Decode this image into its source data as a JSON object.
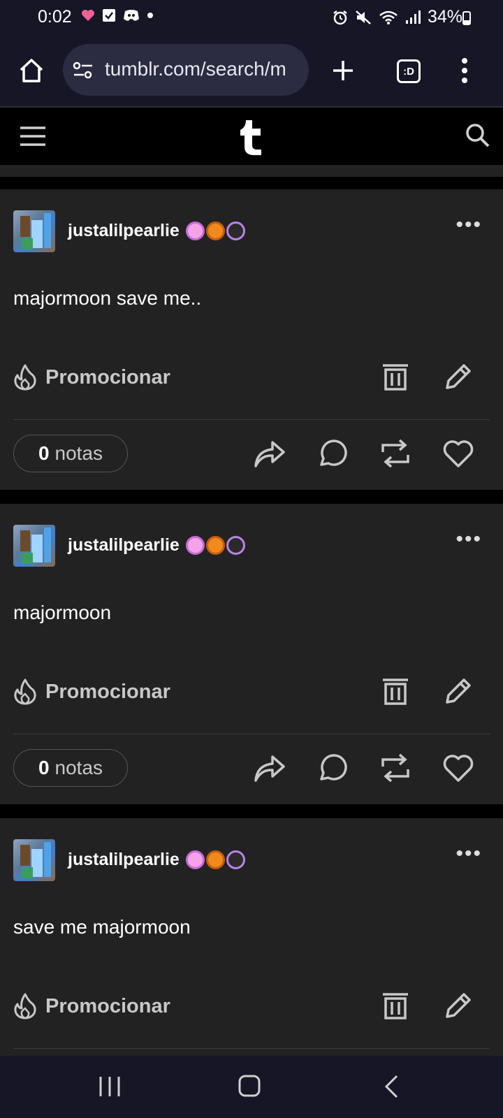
{
  "status_bar": {
    "time": "0:02",
    "battery": "34%"
  },
  "browser": {
    "url": "tumblr.com/search/m",
    "tab_count": ":D"
  },
  "posts": [
    {
      "username": "justalilpearlie",
      "text": "majormoon save me..",
      "promote_label": "Promocionar",
      "notes_count": "0",
      "notes_label": "notas"
    },
    {
      "username": "justalilpearlie",
      "text": "majormoon",
      "promote_label": "Promocionar",
      "notes_count": "0",
      "notes_label": "notas"
    },
    {
      "username": "justalilpearlie",
      "text": "save me majormoon",
      "promote_label": "Promocionar"
    }
  ],
  "colors": {
    "post_bg": "#222222",
    "system_bar_bg": "#161627"
  }
}
